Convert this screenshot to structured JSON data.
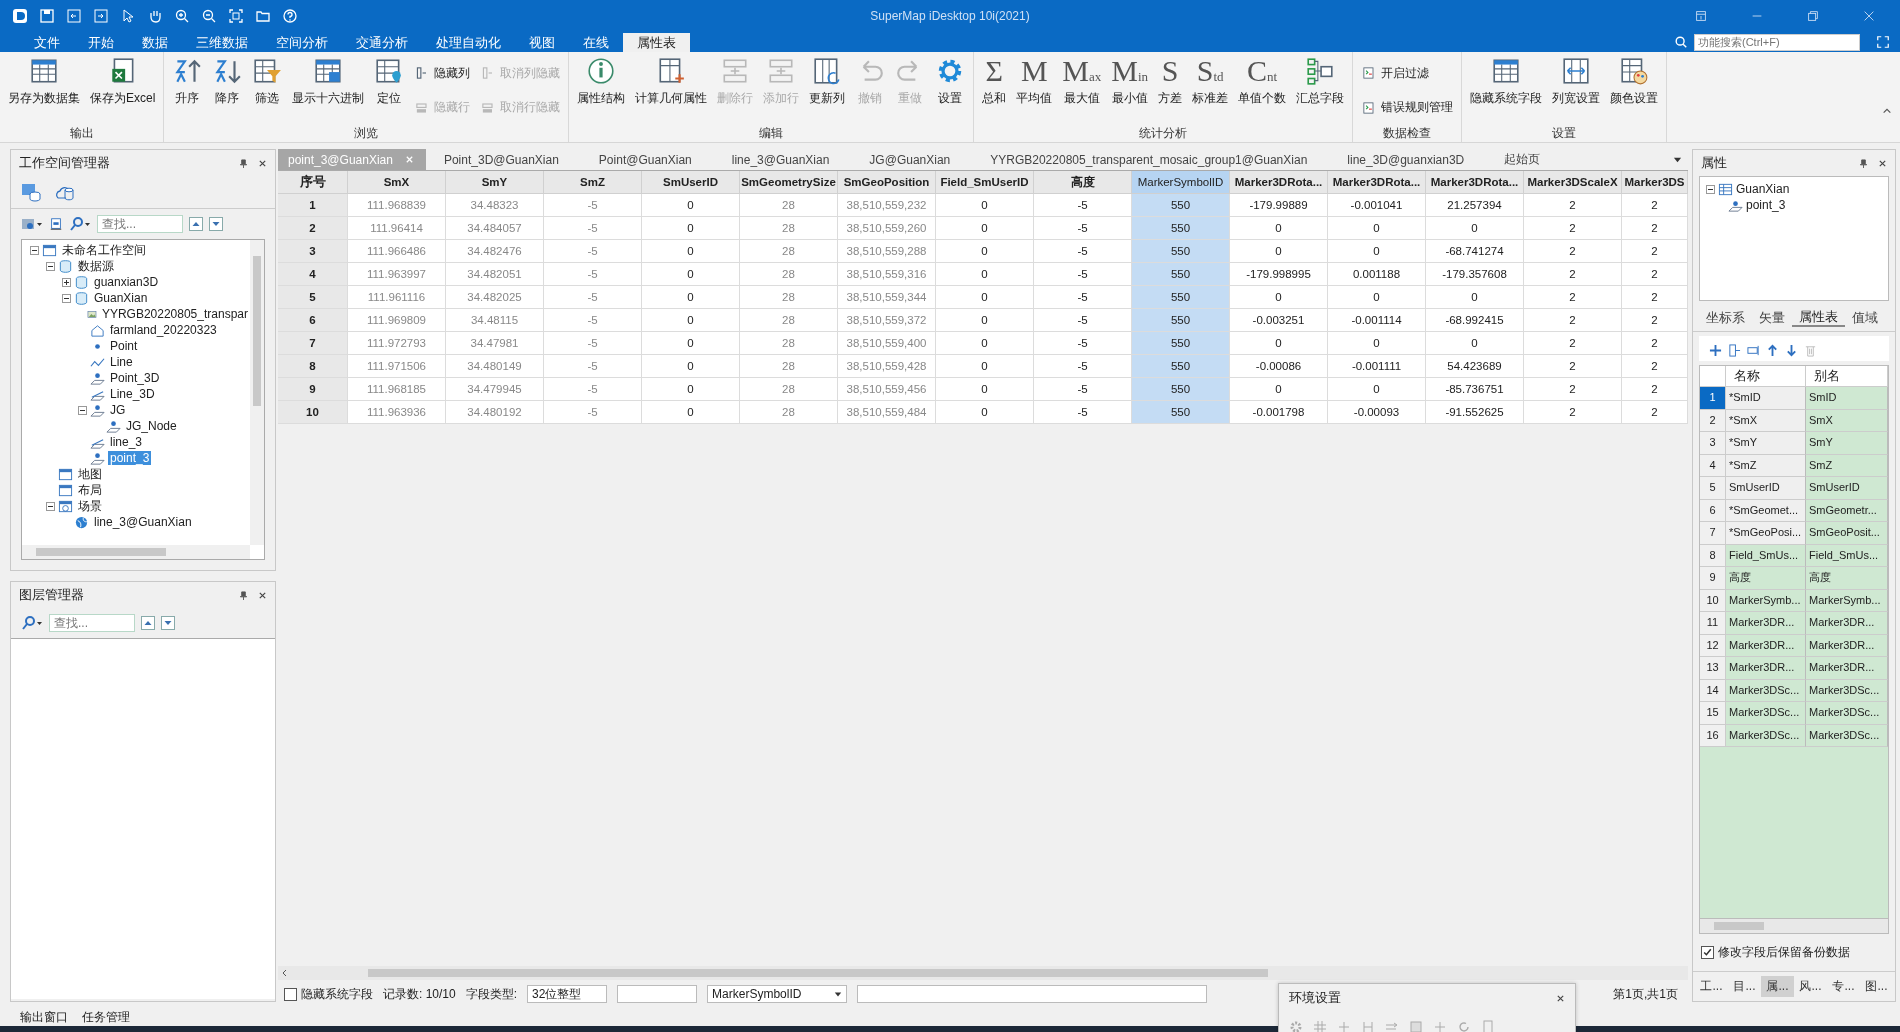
{
  "window": {
    "title": "SuperMap iDesktop 10i(2021)"
  },
  "menu_tabs": [
    {
      "label": "文件",
      "selected": false
    },
    {
      "label": "开始",
      "selected": false
    },
    {
      "label": "数据",
      "selected": false
    },
    {
      "label": "三维数据",
      "selected": false
    },
    {
      "label": "空间分析",
      "selected": false
    },
    {
      "label": "交通分析",
      "selected": false
    },
    {
      "label": "处理自动化",
      "selected": false
    },
    {
      "label": "视图",
      "selected": false
    },
    {
      "label": "在线",
      "selected": false
    },
    {
      "label": "属性表",
      "selected": true
    }
  ],
  "feature_search": {
    "placeholder": "功能搜索(Ctrl+F)"
  },
  "ribbon_groups": [
    {
      "label": "输出",
      "items": [
        {
          "kind": "large",
          "label": "另存为数据集",
          "disabled": false
        },
        {
          "kind": "large",
          "label": "保存为Excel",
          "disabled": false
        }
      ]
    },
    {
      "label": "浏览",
      "items": [
        {
          "kind": "large",
          "label": "升序",
          "disabled": false
        },
        {
          "kind": "large",
          "label": "降序",
          "disabled": false
        },
        {
          "kind": "large",
          "label": "筛选",
          "disabled": false
        },
        {
          "kind": "large",
          "label": "显示十六进制",
          "disabled": false
        },
        {
          "kind": "large",
          "label": "定位",
          "disabled": false
        },
        {
          "kind": "small",
          "label": "隐藏列",
          "disabled": false
        },
        {
          "kind": "small",
          "label": "隐藏行",
          "disabled": true
        },
        {
          "kind": "small",
          "label": "取消列隐藏",
          "disabled": true
        },
        {
          "kind": "small",
          "label": "取消行隐藏",
          "disabled": true
        }
      ]
    },
    {
      "label": "编辑",
      "items": [
        {
          "kind": "large",
          "label": "属性结构",
          "disabled": false
        },
        {
          "kind": "large",
          "label": "计算几何属性",
          "disabled": false
        },
        {
          "kind": "large",
          "label": "删除行",
          "disabled": true
        },
        {
          "kind": "large",
          "label": "添加行",
          "disabled": true
        },
        {
          "kind": "large",
          "label": "更新列",
          "disabled": false
        },
        {
          "kind": "large",
          "label": "撤销",
          "disabled": true
        },
        {
          "kind": "large",
          "label": "重做",
          "disabled": true
        },
        {
          "kind": "large",
          "label": "设置",
          "disabled": false
        }
      ]
    },
    {
      "label": "统计分析",
      "items": [
        {
          "kind": "glyph",
          "glyph": "Σ",
          "label": "总和",
          "disabled": false
        },
        {
          "kind": "glyph",
          "glyph": "M",
          "label": "平均值",
          "disabled": false
        },
        {
          "kind": "glyph",
          "glyph": "M",
          "sub": "ax",
          "label": "最大值",
          "disabled": false
        },
        {
          "kind": "glyph",
          "glyph": "M",
          "sub": "in",
          "label": "最小值",
          "disabled": false
        },
        {
          "kind": "glyph",
          "glyph": "S",
          "label": "方差",
          "disabled": false
        },
        {
          "kind": "glyph",
          "glyph": "S",
          "sub": "td",
          "label": "标准差",
          "disabled": false
        },
        {
          "kind": "glyph",
          "glyph": "C",
          "sub": "nt",
          "label": "单值个数",
          "disabled": false
        },
        {
          "kind": "large",
          "label": "汇总字段",
          "disabled": false
        }
      ]
    },
    {
      "label": "数据检查",
      "items": [
        {
          "kind": "small",
          "label": "开启过滤",
          "disabled": false
        },
        {
          "kind": "small",
          "label": "错误规则管理",
          "disabled": false
        }
      ]
    },
    {
      "label": "设置",
      "items": [
        {
          "kind": "large",
          "label": "隐藏系统字段",
          "disabled": false
        },
        {
          "kind": "large",
          "label": "列宽设置",
          "disabled": false
        },
        {
          "kind": "large",
          "label": "颜色设置",
          "disabled": false
        }
      ]
    }
  ],
  "workspace_manager": {
    "title": "工作空间管理器",
    "search_placeholder": "查找...",
    "tree": [
      {
        "kind": "workspace",
        "label": "未命名工作空间",
        "selected": false,
        "expanded": true,
        "children": [
          {
            "kind": "datasources",
            "label": "数据源",
            "selected": false,
            "expanded": true,
            "children": [
              {
                "kind": "udb",
                "label": "guanxian3D",
                "selected": false,
                "expanded": false
              },
              {
                "kind": "udb",
                "label": "GuanXian",
                "selected": false,
                "expanded": true,
                "children": [
                  {
                    "kind": "image",
                    "label": "YYRGB20220805_transpar",
                    "selected": false
                  },
                  {
                    "kind": "region",
                    "label": "farmland_20220323",
                    "selected": false
                  },
                  {
                    "kind": "point",
                    "label": "Point",
                    "selected": false
                  },
                  {
                    "kind": "line",
                    "label": "Line",
                    "selected": false
                  },
                  {
                    "kind": "point3d",
                    "label": "Point_3D",
                    "selected": false
                  },
                  {
                    "kind": "line3d",
                    "label": "Line_3D",
                    "selected": false
                  },
                  {
                    "kind": "network",
                    "label": "JG",
                    "selected": false,
                    "expanded": true,
                    "children": [
                      {
                        "kind": "point3d",
                        "label": "JG_Node",
                        "selected": false
                      }
                    ]
                  },
                  {
                    "kind": "line3d",
                    "label": "line_3",
                    "selected": false
                  },
                  {
                    "kind": "point3d",
                    "label": "point_3",
                    "selected": true
                  }
                ]
              }
            ]
          },
          {
            "kind": "map",
            "label": "地图",
            "selected": false
          },
          {
            "kind": "layout",
            "label": "布局",
            "selected": false
          },
          {
            "kind": "scene",
            "label": "场景",
            "selected": false,
            "expanded": true,
            "children": [
              {
                "kind": "globe",
                "label": "line_3@GuanXian",
                "selected": false
              }
            ]
          }
        ]
      }
    ]
  },
  "layer_manager": {
    "title": "图层管理器",
    "search_placeholder": "查找..."
  },
  "doc_tabs": [
    {
      "label": "point_3@GuanXian",
      "selected": true
    },
    {
      "label": "Point_3D@GuanXian",
      "selected": false
    },
    {
      "label": "Point@GuanXian",
      "selected": false
    },
    {
      "label": "line_3@GuanXian",
      "selected": false
    },
    {
      "label": "JG@GuanXian",
      "selected": false
    },
    {
      "label": "YYRGB20220805_transparent_mosaic_group1@GuanXian",
      "selected": false
    },
    {
      "label": "line_3D@guanxian3D",
      "selected": false
    },
    {
      "label": "起始页",
      "selected": false
    }
  ],
  "table": {
    "index_header": "序号",
    "columns": [
      {
        "label": "SmX",
        "readonly": true,
        "selected": false
      },
      {
        "label": "SmY",
        "readonly": true,
        "selected": false
      },
      {
        "label": "SmZ",
        "readonly": true,
        "selected": false
      },
      {
        "label": "SmUserID",
        "readonly": false,
        "selected": false
      },
      {
        "label": "SmGeometrySize",
        "readonly": true,
        "selected": false
      },
      {
        "label": "SmGeoPosition",
        "readonly": true,
        "selected": false
      },
      {
        "label": "Field_SmUserID",
        "readonly": false,
        "selected": false
      },
      {
        "label": "高度",
        "readonly": false,
        "selected": false
      },
      {
        "label": "MarkerSymbolID",
        "readonly": false,
        "selected": true
      },
      {
        "label": "Marker3DRota...",
        "readonly": false,
        "selected": false
      },
      {
        "label": "Marker3DRota...",
        "readonly": false,
        "selected": false
      },
      {
        "label": "Marker3DRota...",
        "readonly": false,
        "selected": false
      },
      {
        "label": "Marker3DScaleX",
        "readonly": false,
        "selected": false
      },
      {
        "label": "Marker3DS",
        "readonly": false,
        "selected": false
      }
    ],
    "rows": [
      {
        "index": "1",
        "cells": [
          "111.968839",
          "34.48323",
          "-5",
          "0",
          "28",
          "38,510,559,232",
          "0",
          "-5",
          "550",
          "-179.99889",
          "-0.001041",
          "21.257394",
          "2",
          "2"
        ]
      },
      {
        "index": "2",
        "cells": [
          "111.96414",
          "34.484057",
          "-5",
          "0",
          "28",
          "38,510,559,260",
          "0",
          "-5",
          "550",
          "0",
          "0",
          "0",
          "2",
          "2"
        ]
      },
      {
        "index": "3",
        "cells": [
          "111.966486",
          "34.482476",
          "-5",
          "0",
          "28",
          "38,510,559,288",
          "0",
          "-5",
          "550",
          "0",
          "0",
          "-68.741274",
          "2",
          "2"
        ]
      },
      {
        "index": "4",
        "cells": [
          "111.963997",
          "34.482051",
          "-5",
          "0",
          "28",
          "38,510,559,316",
          "0",
          "-5",
          "550",
          "-179.998995",
          "0.001188",
          "-179.357608",
          "2",
          "2"
        ]
      },
      {
        "index": "5",
        "cells": [
          "111.961116",
          "34.482025",
          "-5",
          "0",
          "28",
          "38,510,559,344",
          "0",
          "-5",
          "550",
          "0",
          "0",
          "0",
          "2",
          "2"
        ]
      },
      {
        "index": "6",
        "cells": [
          "111.969809",
          "34.48115",
          "-5",
          "0",
          "28",
          "38,510,559,372",
          "0",
          "-5",
          "550",
          "-0.003251",
          "-0.001114",
          "-68.992415",
          "2",
          "2"
        ]
      },
      {
        "index": "7",
        "cells": [
          "111.972793",
          "34.47981",
          "-5",
          "0",
          "28",
          "38,510,559,400",
          "0",
          "-5",
          "550",
          "0",
          "0",
          "0",
          "2",
          "2"
        ]
      },
      {
        "index": "8",
        "cells": [
          "111.971506",
          "34.480149",
          "-5",
          "0",
          "28",
          "38,510,559,428",
          "0",
          "-5",
          "550",
          "-0.00086",
          "-0.001111",
          "54.423689",
          "2",
          "2"
        ]
      },
      {
        "index": "9",
        "cells": [
          "111.968185",
          "34.479945",
          "-5",
          "0",
          "28",
          "38,510,559,456",
          "0",
          "-5",
          "550",
          "0",
          "0",
          "-85.736751",
          "2",
          "2"
        ]
      },
      {
        "index": "10",
        "cells": [
          "111.963936",
          "34.480192",
          "-5",
          "0",
          "28",
          "38,510,559,484",
          "0",
          "-5",
          "550",
          "-0.001798",
          "-0.00093",
          "-91.552625",
          "2",
          "2"
        ]
      }
    ]
  },
  "table_status": {
    "hide_system_fields": {
      "label": "隐藏系统字段",
      "checked": false
    },
    "record_count": "记录数: 10/10",
    "field_type_label": "字段类型:",
    "field_type": "32位整型",
    "field_name": "MarkerSymbolID",
    "page": "第1页,共1页"
  },
  "env_panel": {
    "title": "环境设置"
  },
  "properties": {
    "title": "属性",
    "tree": [
      {
        "label": "GuanXian",
        "expanded": true,
        "children": [
          {
            "label": "point_3"
          }
        ]
      }
    ],
    "tabs": [
      {
        "label": "坐标系",
        "selected": false
      },
      {
        "label": "矢量",
        "selected": false
      },
      {
        "label": "属性表",
        "selected": true
      },
      {
        "label": "值域",
        "selected": false
      }
    ],
    "columns": [
      "名称",
      "别名"
    ],
    "fields": [
      {
        "index": "1",
        "name": "*SmID",
        "alias": "SmID",
        "system": true,
        "selected": true
      },
      {
        "index": "2",
        "name": "*SmX",
        "alias": "SmX",
        "system": true,
        "selected": false
      },
      {
        "index": "3",
        "name": "*SmY",
        "alias": "SmY",
        "system": true,
        "selected": false
      },
      {
        "index": "4",
        "name": "*SmZ",
        "alias": "SmZ",
        "system": true,
        "selected": false
      },
      {
        "index": "5",
        "name": "SmUserID",
        "alias": "SmUserID",
        "system": true,
        "selected": false
      },
      {
        "index": "6",
        "name": "*SmGeomet...",
        "alias": "SmGeometr...",
        "system": true,
        "selected": false
      },
      {
        "index": "7",
        "name": "*SmGeoPosi...",
        "alias": "SmGeoPosit...",
        "system": true,
        "selected": false
      },
      {
        "index": "8",
        "name": "Field_SmUs...",
        "alias": "Field_SmUs...",
        "system": false,
        "selected": false
      },
      {
        "index": "9",
        "name": "高度",
        "alias": "高度",
        "system": false,
        "selected": false
      },
      {
        "index": "10",
        "name": "MarkerSymb...",
        "alias": "MarkerSymb...",
        "system": false,
        "selected": false
      },
      {
        "index": "11",
        "name": "Marker3DR...",
        "alias": "Marker3DR...",
        "system": false,
        "selected": false
      },
      {
        "index": "12",
        "name": "Marker3DR...",
        "alias": "Marker3DR...",
        "system": false,
        "selected": false
      },
      {
        "index": "13",
        "name": "Marker3DR...",
        "alias": "Marker3DR...",
        "system": false,
        "selected": false
      },
      {
        "index": "14",
        "name": "Marker3DSc...",
        "alias": "Marker3DSc...",
        "system": false,
        "selected": false
      },
      {
        "index": "15",
        "name": "Marker3DSc...",
        "alias": "Marker3DSc...",
        "system": false,
        "selected": false
      },
      {
        "index": "16",
        "name": "Marker3DSc...",
        "alias": "Marker3DSc...",
        "system": false,
        "selected": false
      }
    ],
    "keep_backup": {
      "label": "修改字段后保留备份数据",
      "checked": true
    },
    "bottom_tabs": [
      {
        "label": "工...",
        "selected": false
      },
      {
        "label": "目...",
        "selected": false
      },
      {
        "label": "属...",
        "selected": true
      },
      {
        "label": "风...",
        "selected": false
      },
      {
        "label": "专...",
        "selected": false
      },
      {
        "label": "图...",
        "selected": false
      }
    ]
  },
  "bottom_tabs": [
    "输出窗口",
    "任务管理"
  ]
}
